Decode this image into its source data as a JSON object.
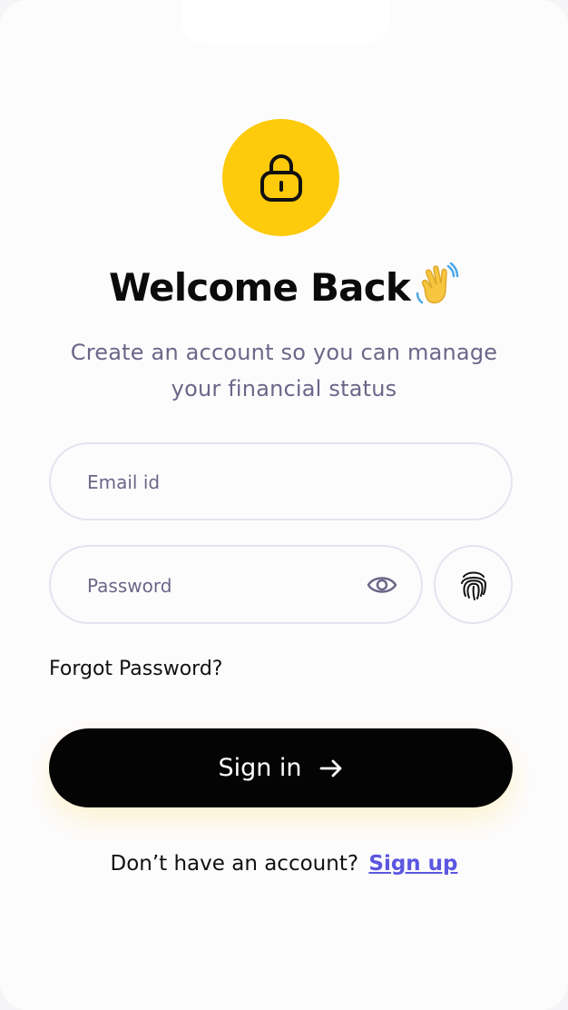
{
  "header": {
    "title": "Welcome Back",
    "subtitle_line1": "Create an account so you can manage",
    "subtitle_line2": "your financial status"
  },
  "form": {
    "email_placeholder": "Email id",
    "email_value": "",
    "password_placeholder": "Password",
    "password_value": "",
    "forgot_label": "Forgot Password?",
    "signin_label": "Sign in"
  },
  "footer": {
    "prompt": "Don’t have an account?",
    "signup_label": "Sign up"
  },
  "icons": {
    "lock": "lock-icon",
    "wave": "waving-hand-icon",
    "eye": "eye-icon",
    "fingerprint": "fingerprint-icon",
    "arrow": "arrow-right-icon"
  },
  "colors": {
    "accent": "#fdca0c",
    "primary_button": "#050405",
    "link": "#5b57e0",
    "muted_text": "#6b6788"
  }
}
